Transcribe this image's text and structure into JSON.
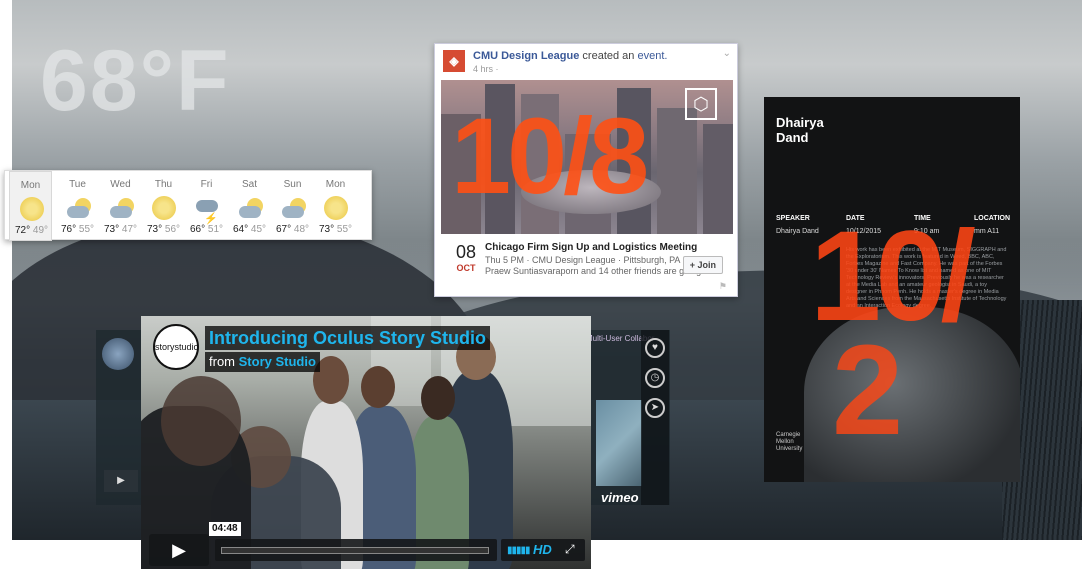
{
  "weather_overlay": {
    "temperature": "68°F",
    "days": [
      {
        "day": "Mon",
        "high": "72°",
        "low": "49°",
        "icon": "sunny-icon",
        "selected": true
      },
      {
        "day": "Tue",
        "high": "76°",
        "low": "55°",
        "icon": "partly-cloudy-icon"
      },
      {
        "day": "Wed",
        "high": "73°",
        "low": "47°",
        "icon": "partly-cloudy-icon"
      },
      {
        "day": "Thu",
        "high": "73°",
        "low": "56°",
        "icon": "sunny-icon"
      },
      {
        "day": "Fri",
        "high": "66°",
        "low": "51°",
        "icon": "thunderstorm-icon"
      },
      {
        "day": "Sat",
        "high": "64°",
        "low": "45°",
        "icon": "partly-cloudy-icon"
      },
      {
        "day": "Sun",
        "high": "67°",
        "low": "48°",
        "icon": "partly-cloudy-icon"
      },
      {
        "day": "Mon",
        "high": "73°",
        "low": "55°",
        "icon": "sunny-icon"
      }
    ]
  },
  "facebook_post": {
    "page_name": "CMU Design League",
    "action_text": "created an",
    "event_link": "event.",
    "time_ago": "4 hrs ·",
    "overlay_date": "10/8",
    "event_day": "08",
    "event_month": "OCT",
    "event_title": "Chicago Firm Sign Up and Logistics Meeting",
    "event_details": "Thu 5 PM · CMU Design League · Pittsburgh, PA",
    "friends_going": "Praew Suntiasvaraporn and 14 other friends are going",
    "join_label": "+ Join"
  },
  "poster": {
    "name": "Dhairya\nDand",
    "labels": {
      "speaker": "SPEAKER",
      "date": "DATE",
      "time": "TIME",
      "location": "LOCATION"
    },
    "values": {
      "speaker": "Dhairya Dand",
      "date": "10/12/2015",
      "time": "9:10 am",
      "location": "mm A11"
    },
    "overlay_date_top": "10/",
    "overlay_date_bottom": "2",
    "body_text": "His work has been exhibited at the MIT Museum, SIGGRAPH and the Exploratorium. This work is featured in Wired, BBC, ABC, Forbes Magazine and Fast Company. He was part of the Forbes '30 under 30' Names To Know list and named as one of MIT Technology Review's innovators. Previously he was a researcher at the Media Lab and an amateur geologist in Saudi, a toy designer in Phnom Penh. He holds a master's degree in Media Arts and Sciences from the Massachusetts Institute of Technology and an Interaction Ecology degree.",
    "university": "Carnegie\nMellon\nUniversity"
  },
  "vimeo_background": {
    "caption": "Multi-User Collabor",
    "brand": "vimeo",
    "play_label": "▶"
  },
  "video": {
    "badge": "storystudio",
    "title": "Introducing Oculus Story Studio",
    "from_prefix": "from",
    "from_author": "Story Studio",
    "timestamp": "04:48",
    "progress": 0.0,
    "hd_label": "HD",
    "volume_icon": "volume-icon",
    "fullscreen_icon": "fullscreen-icon"
  },
  "colors": {
    "accent_orange": "#ff5014",
    "vimeo_blue": "#1fb5ec",
    "facebook_blue": "#3b5998"
  }
}
